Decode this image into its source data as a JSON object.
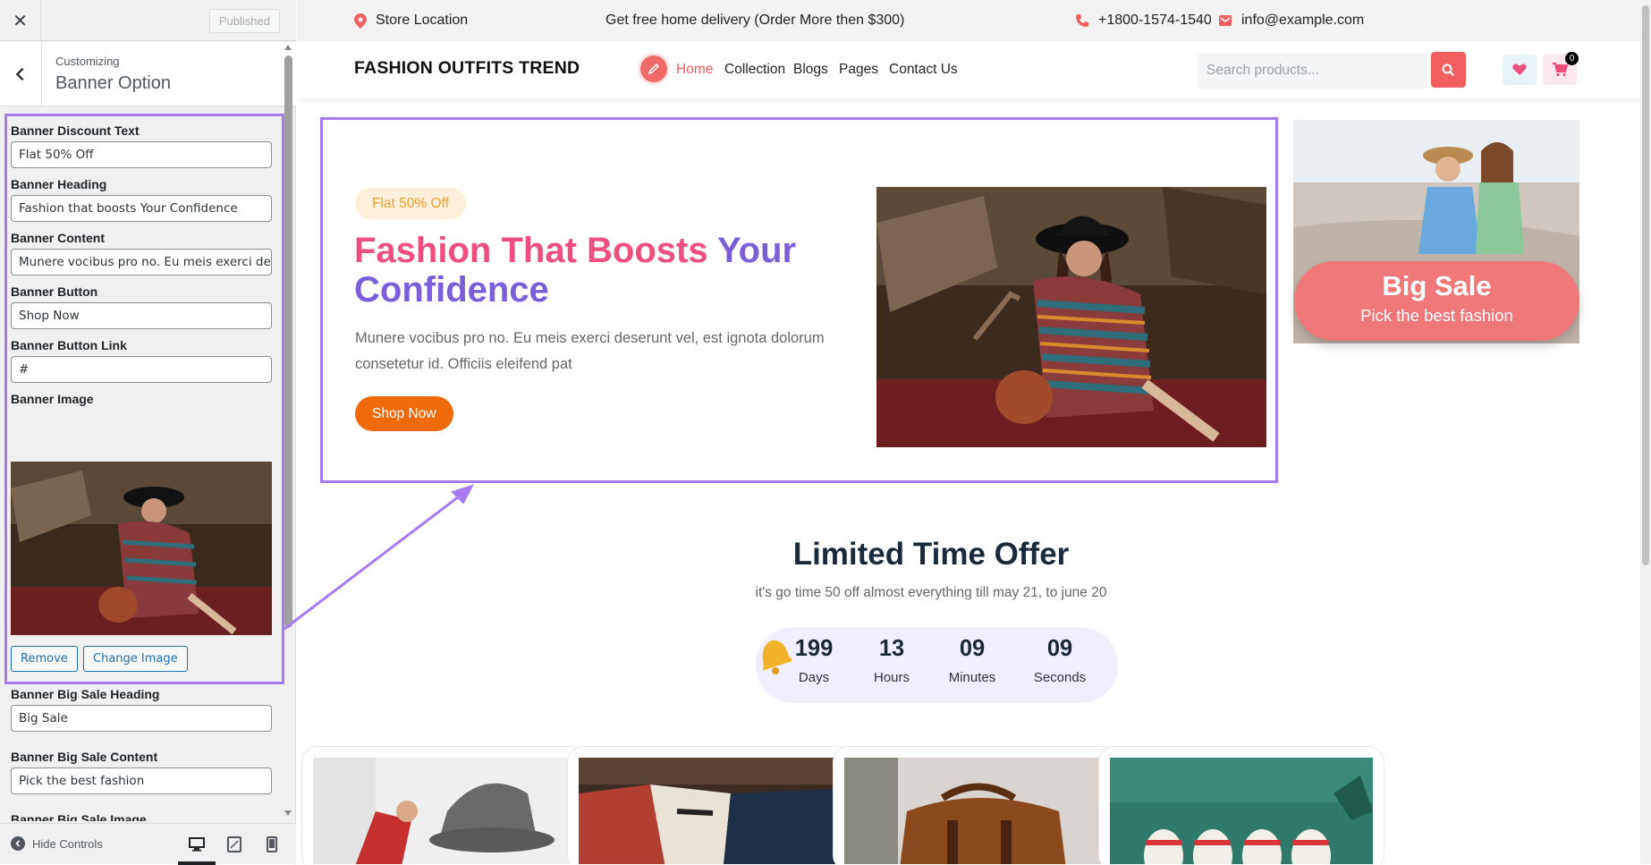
{
  "customizer": {
    "published_label": "Published",
    "customizing_label": "Customizing",
    "section_title": "Banner Option",
    "fields": [
      {
        "label": "Banner Discount Text",
        "value": "Flat 50% Off"
      },
      {
        "label": "Banner Heading",
        "value": "Fashion that boosts Your Confidence"
      },
      {
        "label": "Banner Content",
        "value": "Munere vocibus pro no. Eu meis exerci deser"
      },
      {
        "label": "Banner Button",
        "value": "Shop Now"
      },
      {
        "label": "Banner Button Link",
        "value": "#"
      }
    ],
    "image_label": "Banner Image",
    "remove_label": "Remove",
    "change_image_label": "Change Image",
    "bigsale_heading_label": "Banner Big Sale Heading",
    "bigsale_heading_value": "Big Sale",
    "bigsale_content_label": "Banner Big Sale Content",
    "bigsale_content_value": "Pick the best fashion",
    "bigsale_image_label": "Banner Big Sale Image",
    "hide_controls": "Hide Controls"
  },
  "site": {
    "topbar": {
      "store_location": "Store Location",
      "delivery": "Get free home delivery (Order More then $300)",
      "phone": "+1800-1574-1540",
      "email": "info@example.com"
    },
    "logo": "FASHION OUTFITS TREND",
    "nav": [
      "Home",
      "Collection",
      "Blogs",
      "Pages",
      "Contact Us"
    ],
    "search_placeholder": "Search products...",
    "cart_count": "0",
    "banner": {
      "discount": "Flat 50% Off",
      "heading_pink": "Fashion That Boosts",
      "heading_violet": "Your Confidence",
      "content": "Munere vocibus pro no. Eu meis exerci deserunt vel, est ignota dolorum consetetur id. Officiis eleifend pat",
      "button": "Shop Now"
    },
    "bigsale": {
      "heading": "Big Sale",
      "content": "Pick the best fashion"
    },
    "offer": {
      "title": "Limited Time Offer",
      "subtitle": "it's go time 50 off almost everything till may 21, to june 20",
      "countdown": [
        {
          "value": "199",
          "label": "Days"
        },
        {
          "value": "13",
          "label": "Hours"
        },
        {
          "value": "09",
          "label": "Minutes"
        },
        {
          "value": "09",
          "label": "Seconds"
        }
      ]
    }
  },
  "colors": {
    "accent_red": "#f06060",
    "highlight": "#a67cf0",
    "heading_pink": "#ee4f7f",
    "heading_violet": "#7b5fd9",
    "button_orange": "#ef6a0a"
  }
}
